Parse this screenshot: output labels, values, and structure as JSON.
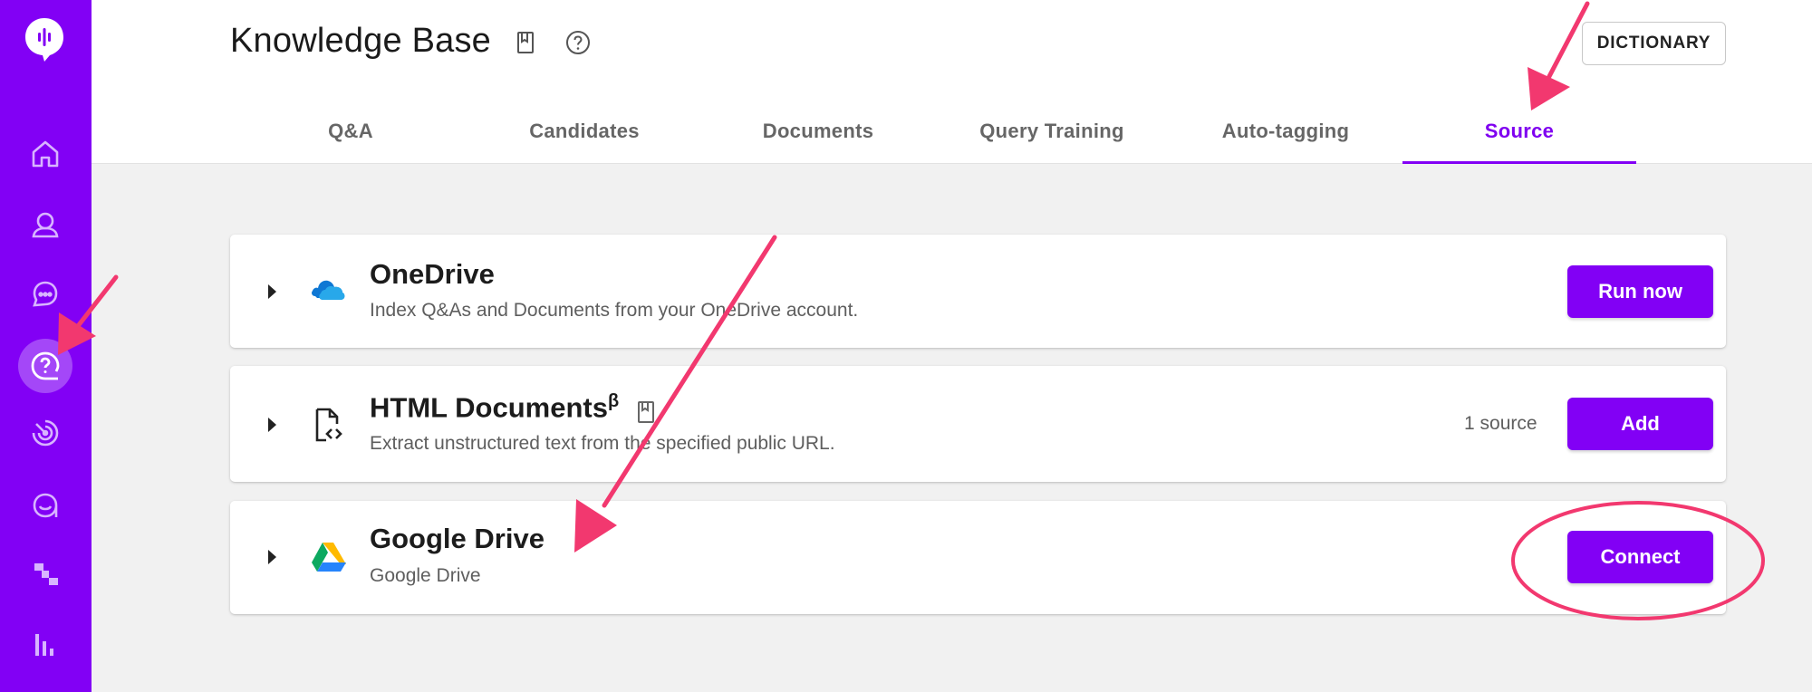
{
  "header": {
    "title": "Knowledge Base",
    "dictionary_button": "DICTIONARY"
  },
  "tabs": [
    {
      "label": "Q&A",
      "active": false
    },
    {
      "label": "Candidates",
      "active": false
    },
    {
      "label": "Documents",
      "active": false
    },
    {
      "label": "Query Training",
      "active": false
    },
    {
      "label": "Auto-tagging",
      "active": false
    },
    {
      "label": "Source",
      "active": true
    }
  ],
  "sidebar": {
    "items": [
      {
        "icon": "home-icon"
      },
      {
        "icon": "user-icon"
      },
      {
        "icon": "chat-icon"
      },
      {
        "icon": "help-circle-icon",
        "active": true
      },
      {
        "icon": "radar-icon"
      },
      {
        "icon": "message-smile-icon"
      },
      {
        "icon": "flow-icon"
      },
      {
        "icon": "bar-chart-icon"
      }
    ]
  },
  "sources": [
    {
      "name": "OneDrive",
      "description": "Index Q&As and Documents from your OneDrive account.",
      "icon": "onedrive-icon",
      "action": "Run now"
    },
    {
      "name": "HTML Documents",
      "superscript": "β",
      "description": "Extract unstructured text from the specified public URL.",
      "icon": "html-file-icon",
      "count": "1 source",
      "action": "Add"
    },
    {
      "name": "Google Drive",
      "description": "Google Drive",
      "icon": "google-drive-icon",
      "action": "Connect"
    }
  ],
  "colors": {
    "brand": "#8200f5",
    "annotation": "#f2386f"
  }
}
